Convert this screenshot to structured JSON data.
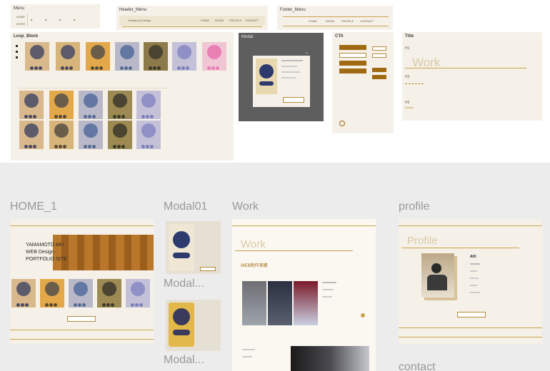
{
  "top_frames": {
    "menu": {
      "title": "Menu",
      "items": [
        "HOME",
        "WORK"
      ]
    },
    "header_menu": {
      "title": "Header_Menu",
      "logo": "Yamamoto Design",
      "items": [
        "HOME",
        "WORK",
        "PROFILE",
        "CONTACT"
      ]
    },
    "footer_menu": {
      "title": "Footer_Menu",
      "items": [
        "HOME",
        "WORK",
        "PROFILE",
        "CONTACT"
      ]
    },
    "loop_block": {
      "title": "Loop_Block"
    },
    "modal": {
      "title": "Modal"
    },
    "cta": {
      "title": "CTA"
    },
    "title": {
      "title": "Title",
      "h1": "H1",
      "work": "Work",
      "h2": "H2",
      "h3": "H3"
    }
  },
  "frames": {
    "home": {
      "label": "HOME_1",
      "hero_line1": "YAMAMOTO AKI",
      "hero_line2": "WEB Design",
      "hero_line3": "PORTFOLIO SITE"
    },
    "modal01": {
      "label": "Modal01"
    },
    "modal02": {
      "label": "Modal..."
    },
    "modal03": {
      "label": "Modal..."
    },
    "work": {
      "label": "Work",
      "heading": "Work",
      "section": "WEB制作実績"
    },
    "profile": {
      "label": "profile",
      "heading": "Profile",
      "name": "AKI"
    },
    "contact": {
      "label": "contact"
    }
  },
  "colors": {
    "panel_bg": "#f5f1e9",
    "accent_gold": "#c9a24a",
    "accent_brown": "#a06a12",
    "dark_modal": "#5e5e5e"
  }
}
